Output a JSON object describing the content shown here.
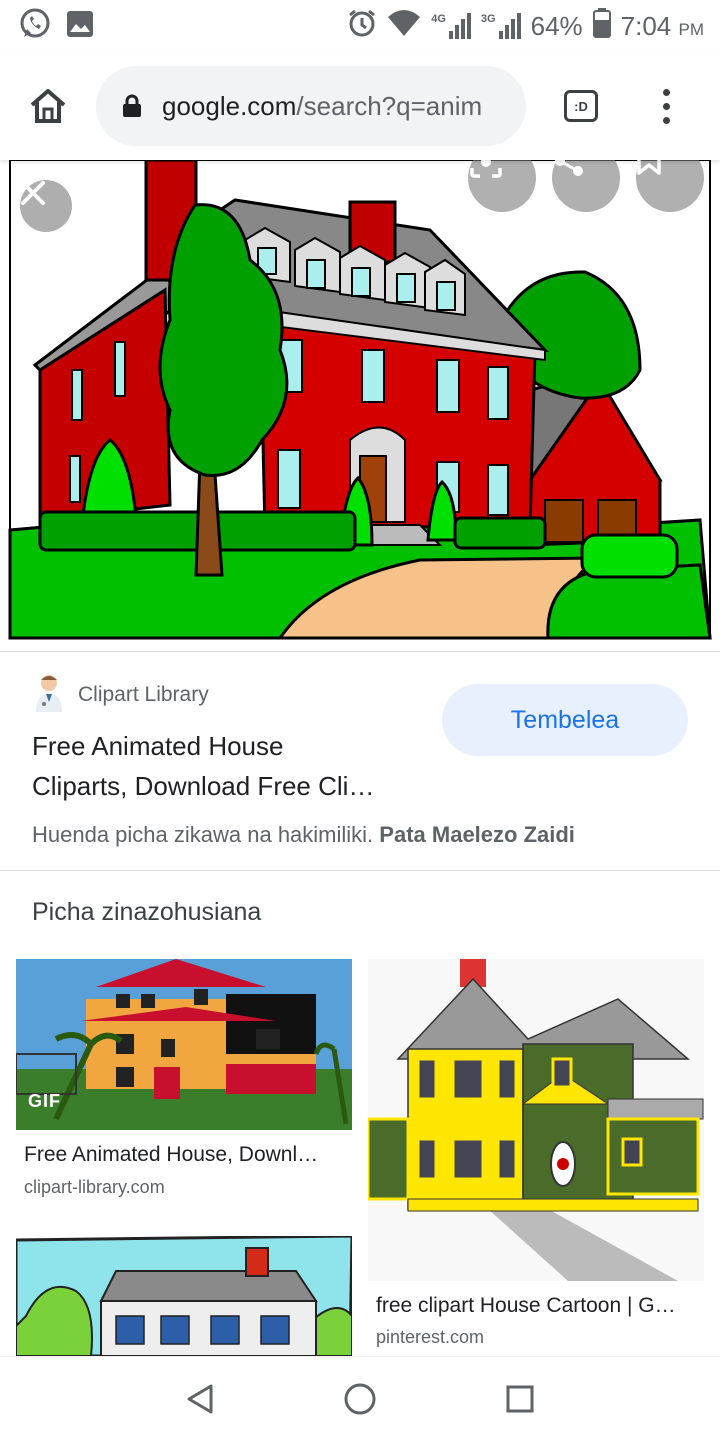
{
  "status_bar": {
    "time": "7:04",
    "ampm": "PM",
    "battery": "64%",
    "net1": "4G",
    "net2": "3G"
  },
  "browser": {
    "url_host": "google.com",
    "url_path": "/search?q=anim",
    "tab_label": ":D"
  },
  "result": {
    "source_name": "Clipart Library",
    "title_line1": "Free Animated House",
    "title_line2": "Cliparts, Download Free Cli…",
    "visit_label": "Tembelea",
    "copyright_text": "Huenda picha zikawa na hakimiliki.",
    "learn_more": "Pata Maelezo Zaidi"
  },
  "related": {
    "heading": "Picha zinazohusiana",
    "items": [
      {
        "title": "Free Animated House, Downl…",
        "domain": "clipart-library.com",
        "badge": "GIF"
      },
      {
        "title": "free clipart House Cartoon | G…",
        "domain": "pinterest.com"
      }
    ]
  },
  "colors": {
    "accent": "#1a73e8",
    "chip_bg": "#e8f0fe"
  }
}
